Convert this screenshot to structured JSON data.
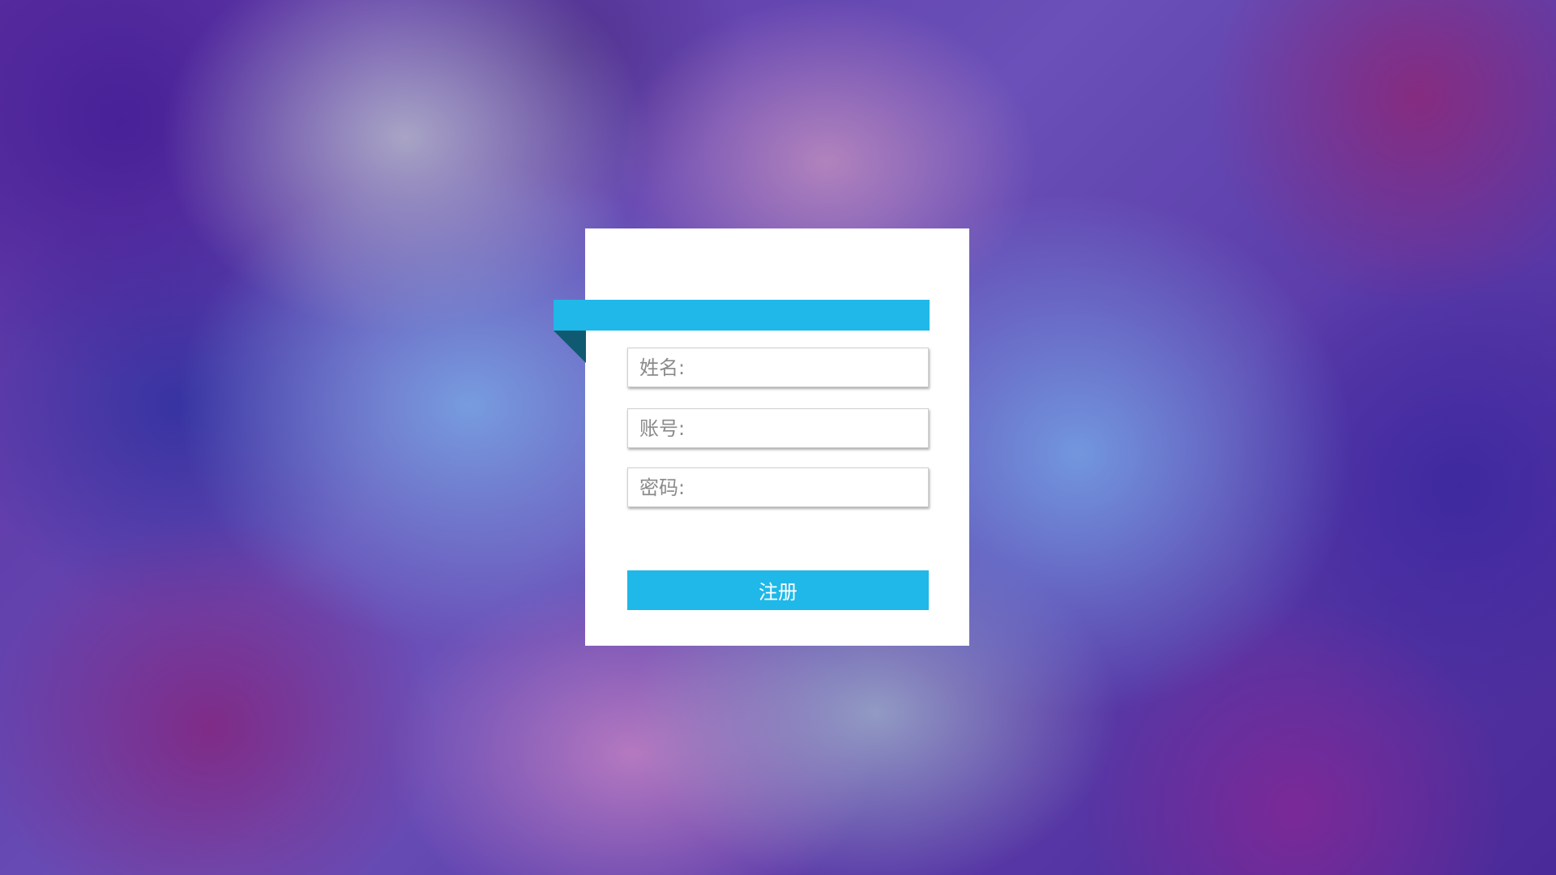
{
  "form": {
    "name_placeholder": "姓名:",
    "account_placeholder": "账号:",
    "password_placeholder": "密码:",
    "submit_label": "注册"
  },
  "colors": {
    "accent": "#1fb8e8",
    "ribbon_fold": "#0f5a70",
    "card": "#ffffff"
  }
}
